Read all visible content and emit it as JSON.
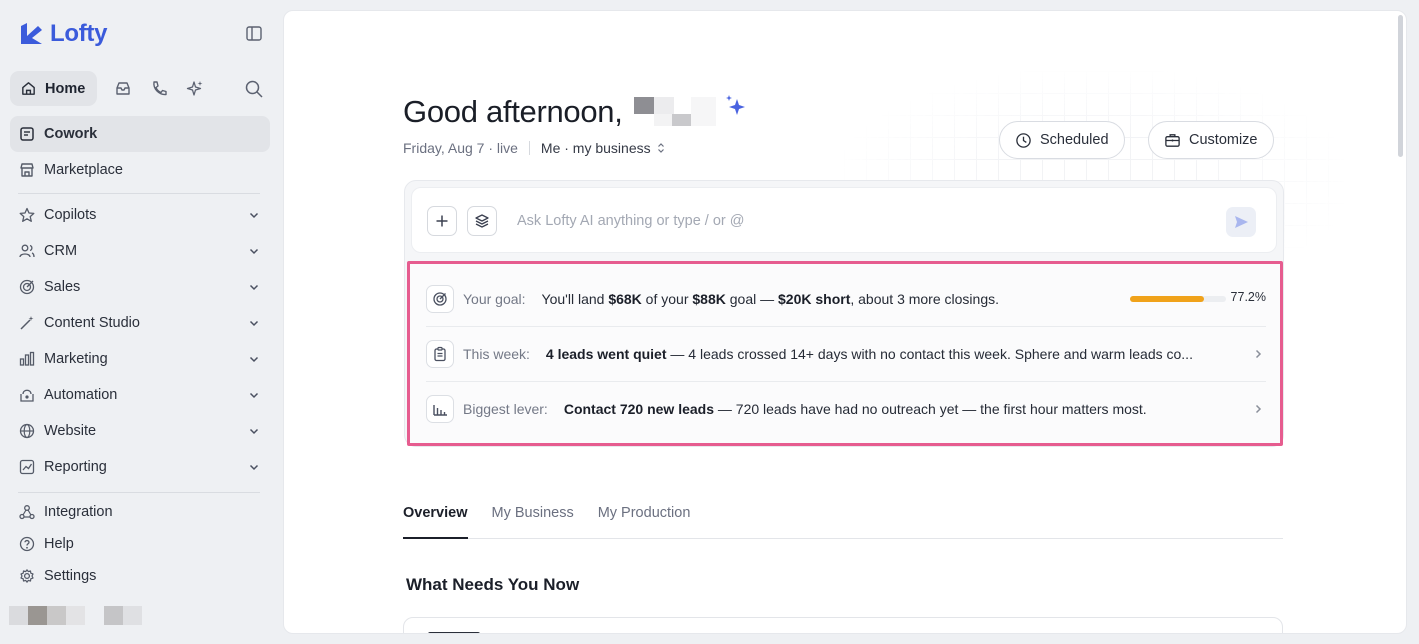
{
  "app": {
    "name": "Lofty",
    "brand_color": "#3b5bdb"
  },
  "sidebar": {
    "home_label": "Home",
    "top_items": [
      {
        "label": "Cowork",
        "icon": "cowork-icon"
      },
      {
        "label": "Marketplace",
        "icon": "store-icon"
      }
    ],
    "groups": [
      {
        "label": "Copilots",
        "icon": "star-icon"
      },
      {
        "label": "CRM",
        "icon": "users-icon"
      },
      {
        "label": "Sales",
        "icon": "target-icon"
      },
      {
        "label": "Content Studio",
        "icon": "magic-wand-icon"
      },
      {
        "label": "Marketing",
        "icon": "bar-chart-icon"
      },
      {
        "label": "Automation",
        "icon": "automation-icon"
      },
      {
        "label": "Website",
        "icon": "globe-icon"
      },
      {
        "label": "Reporting",
        "icon": "line-chart-icon"
      }
    ],
    "bottom_items": [
      {
        "label": "Integration",
        "icon": "integration-icon"
      },
      {
        "label": "Help",
        "icon": "help-icon"
      },
      {
        "label": "Settings",
        "icon": "gear-icon"
      }
    ]
  },
  "header": {
    "greeting": "Good afternoon,",
    "date": "Friday, Aug 7 · live",
    "scope": "Me · my business",
    "scheduled_label": "Scheduled",
    "customize_label": "Customize"
  },
  "ai": {
    "placeholder": "Ask Lofty AI anything or type / or @"
  },
  "insights": {
    "goal": {
      "label": "Your goal:",
      "prefix": "You'll land ",
      "landed": "$68K",
      "mid": " of your ",
      "goal": "$88K",
      "mid2": " goal — ",
      "short": "$20K short",
      "suffix": ", about 3 more closings.",
      "progress": 0.772,
      "progress_text": "77.2%",
      "progress_color": "#f0a21a"
    },
    "week": {
      "label": "This week:",
      "headline": "4 leads went quiet",
      "detail": " — 4 leads crossed 14+ days with no contact this week. Sphere and warm leads co..."
    },
    "lever": {
      "label": "Biggest lever:",
      "headline": "Contact 720 new leads",
      "detail": " — 720 leads have had no outreach yet — the first hour matters most."
    },
    "highlight_color": "#e65c8f"
  },
  "tabs": [
    {
      "label": "Overview",
      "active": true
    },
    {
      "label": "My Business",
      "active": false
    },
    {
      "label": "My Production",
      "active": false
    }
  ],
  "section": {
    "title": "What Needs You Now"
  }
}
